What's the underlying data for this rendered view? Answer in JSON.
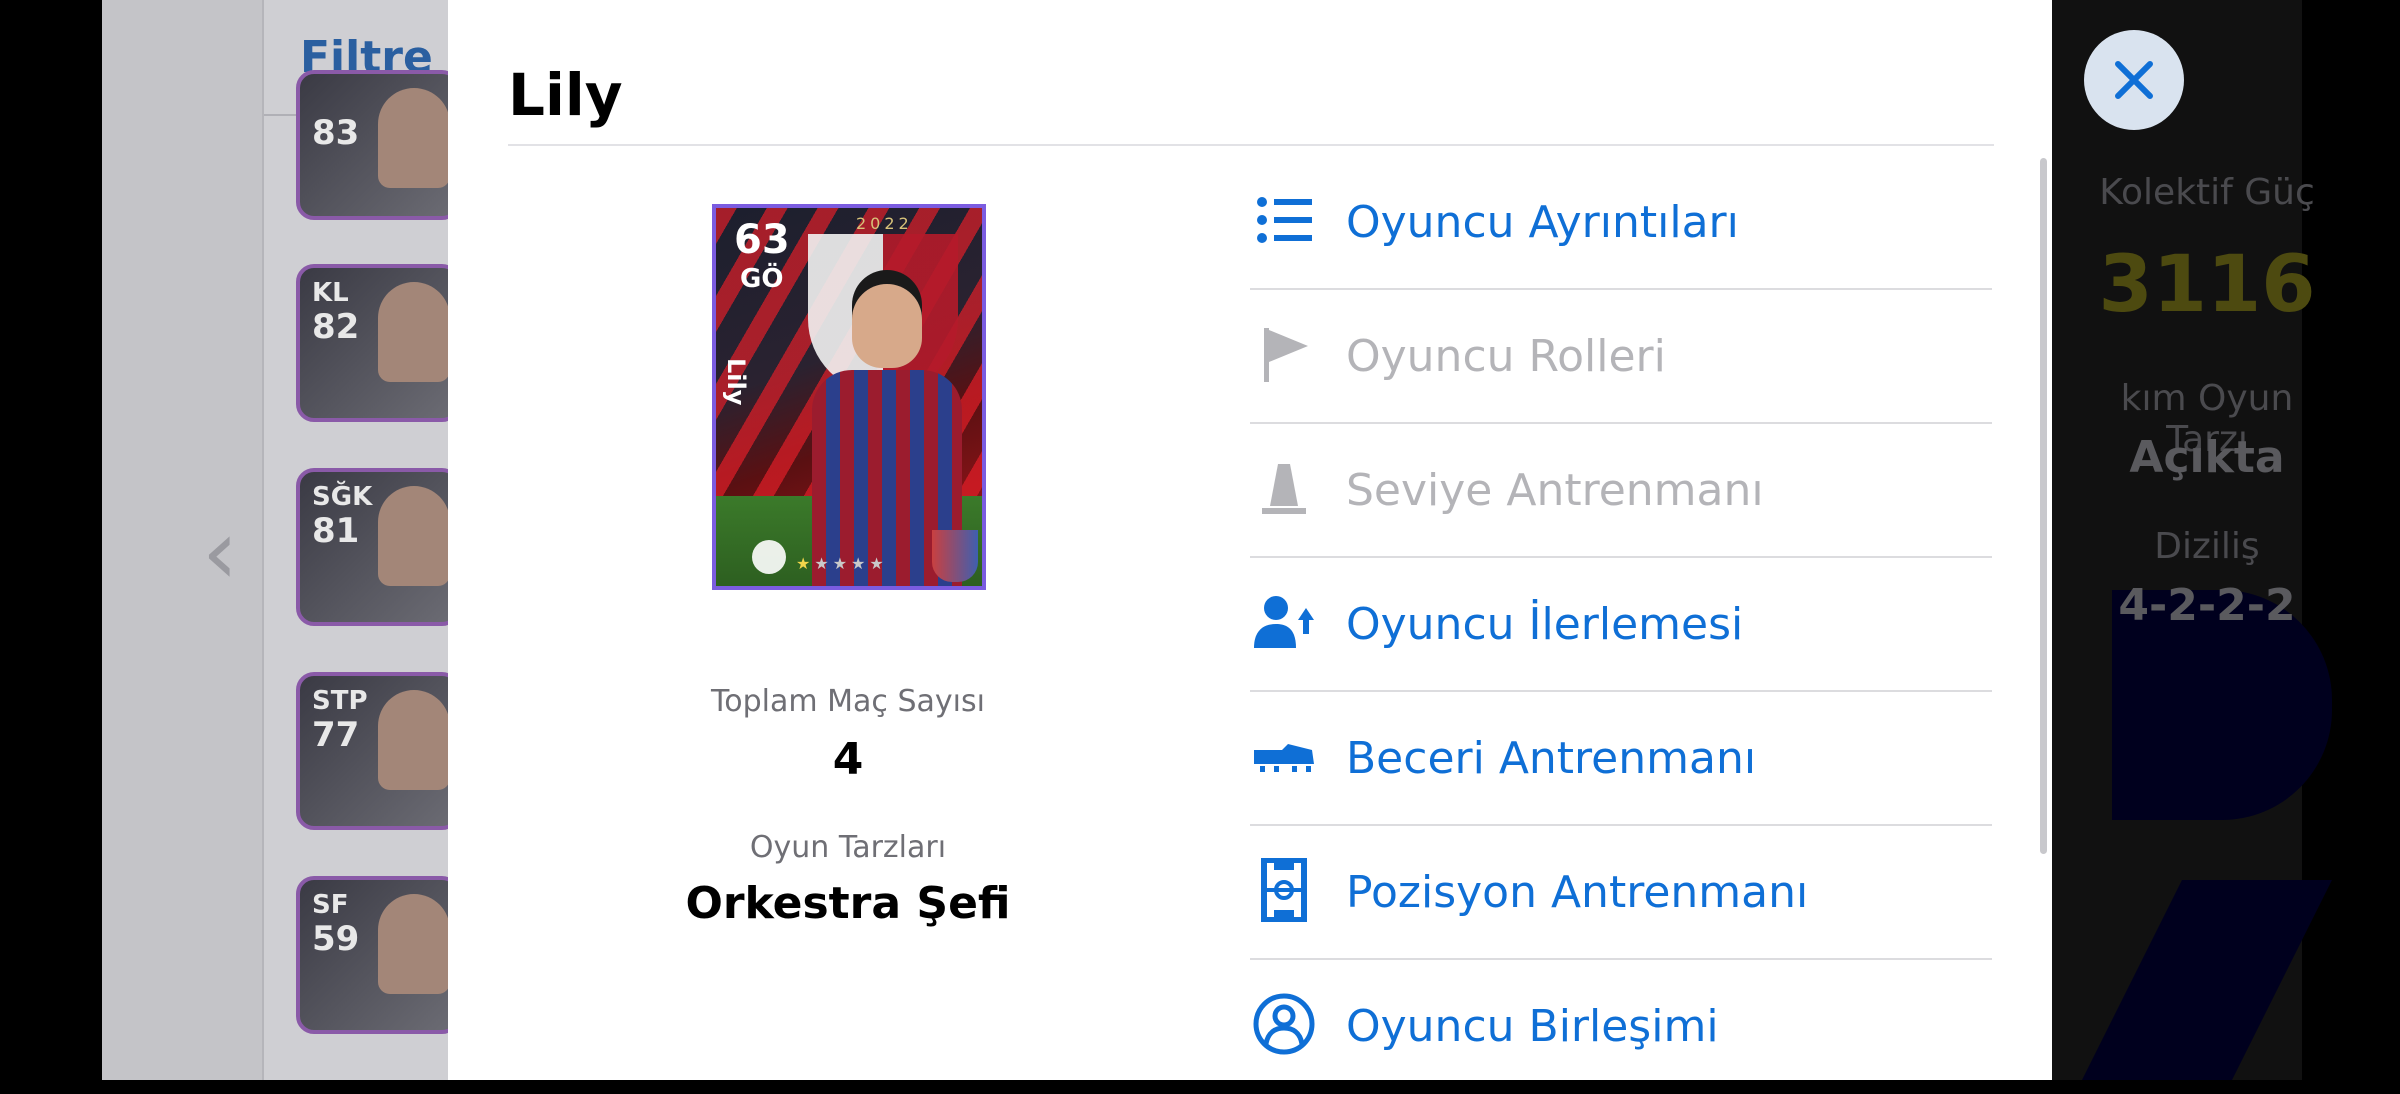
{
  "filter": {
    "label": "Filtre"
  },
  "background_cards": [
    {
      "pos": "",
      "ovr": "83"
    },
    {
      "pos": "KL",
      "ovr": "82"
    },
    {
      "pos": "SĞK",
      "ovr": "81"
    },
    {
      "pos": "STP",
      "ovr": "77"
    },
    {
      "pos": "SF",
      "ovr": "59"
    }
  ],
  "stats": {
    "power_label": "Kolektif Güç",
    "power_value": "3116",
    "playstyle_label": "kım Oyun Tarzı",
    "playstyle_value": "Açıkta",
    "formation_label": "Diziliş",
    "formation_value": "4-2-2-2"
  },
  "modal": {
    "title": "Lily",
    "card": {
      "overall": "63",
      "position": "GÖ",
      "year": "2022",
      "name": "Lily",
      "stars_filled": 1,
      "stars_total": 5
    },
    "total_matches_label": "Toplam Maç Sayısı",
    "total_matches_value": "4",
    "playstyle_label": "Oyun Tarzları",
    "playstyle_value": "Orkestra Şefi",
    "menu": [
      {
        "label": "Oyuncu Ayrıntıları",
        "icon": "list-icon",
        "enabled": true
      },
      {
        "label": "Oyuncu Rolleri",
        "icon": "flag-icon",
        "enabled": false
      },
      {
        "label": "Seviye Antrenmanı",
        "icon": "training-cone-icon",
        "enabled": false
      },
      {
        "label": "Oyuncu İlerlemesi",
        "icon": "player-progress-icon",
        "enabled": true
      },
      {
        "label": "Beceri Antrenmanı",
        "icon": "football-boot-icon",
        "enabled": true
      },
      {
        "label": "Pozisyon Antrenmanı",
        "icon": "pitch-icon",
        "enabled": true
      },
      {
        "label": "Oyuncu Birleşimi",
        "icon": "player-combine-icon",
        "enabled": true
      }
    ]
  },
  "colors": {
    "accent": "#0f6fd6",
    "disabled": "#b4b4b8",
    "card_border": "#7b5ce0"
  }
}
